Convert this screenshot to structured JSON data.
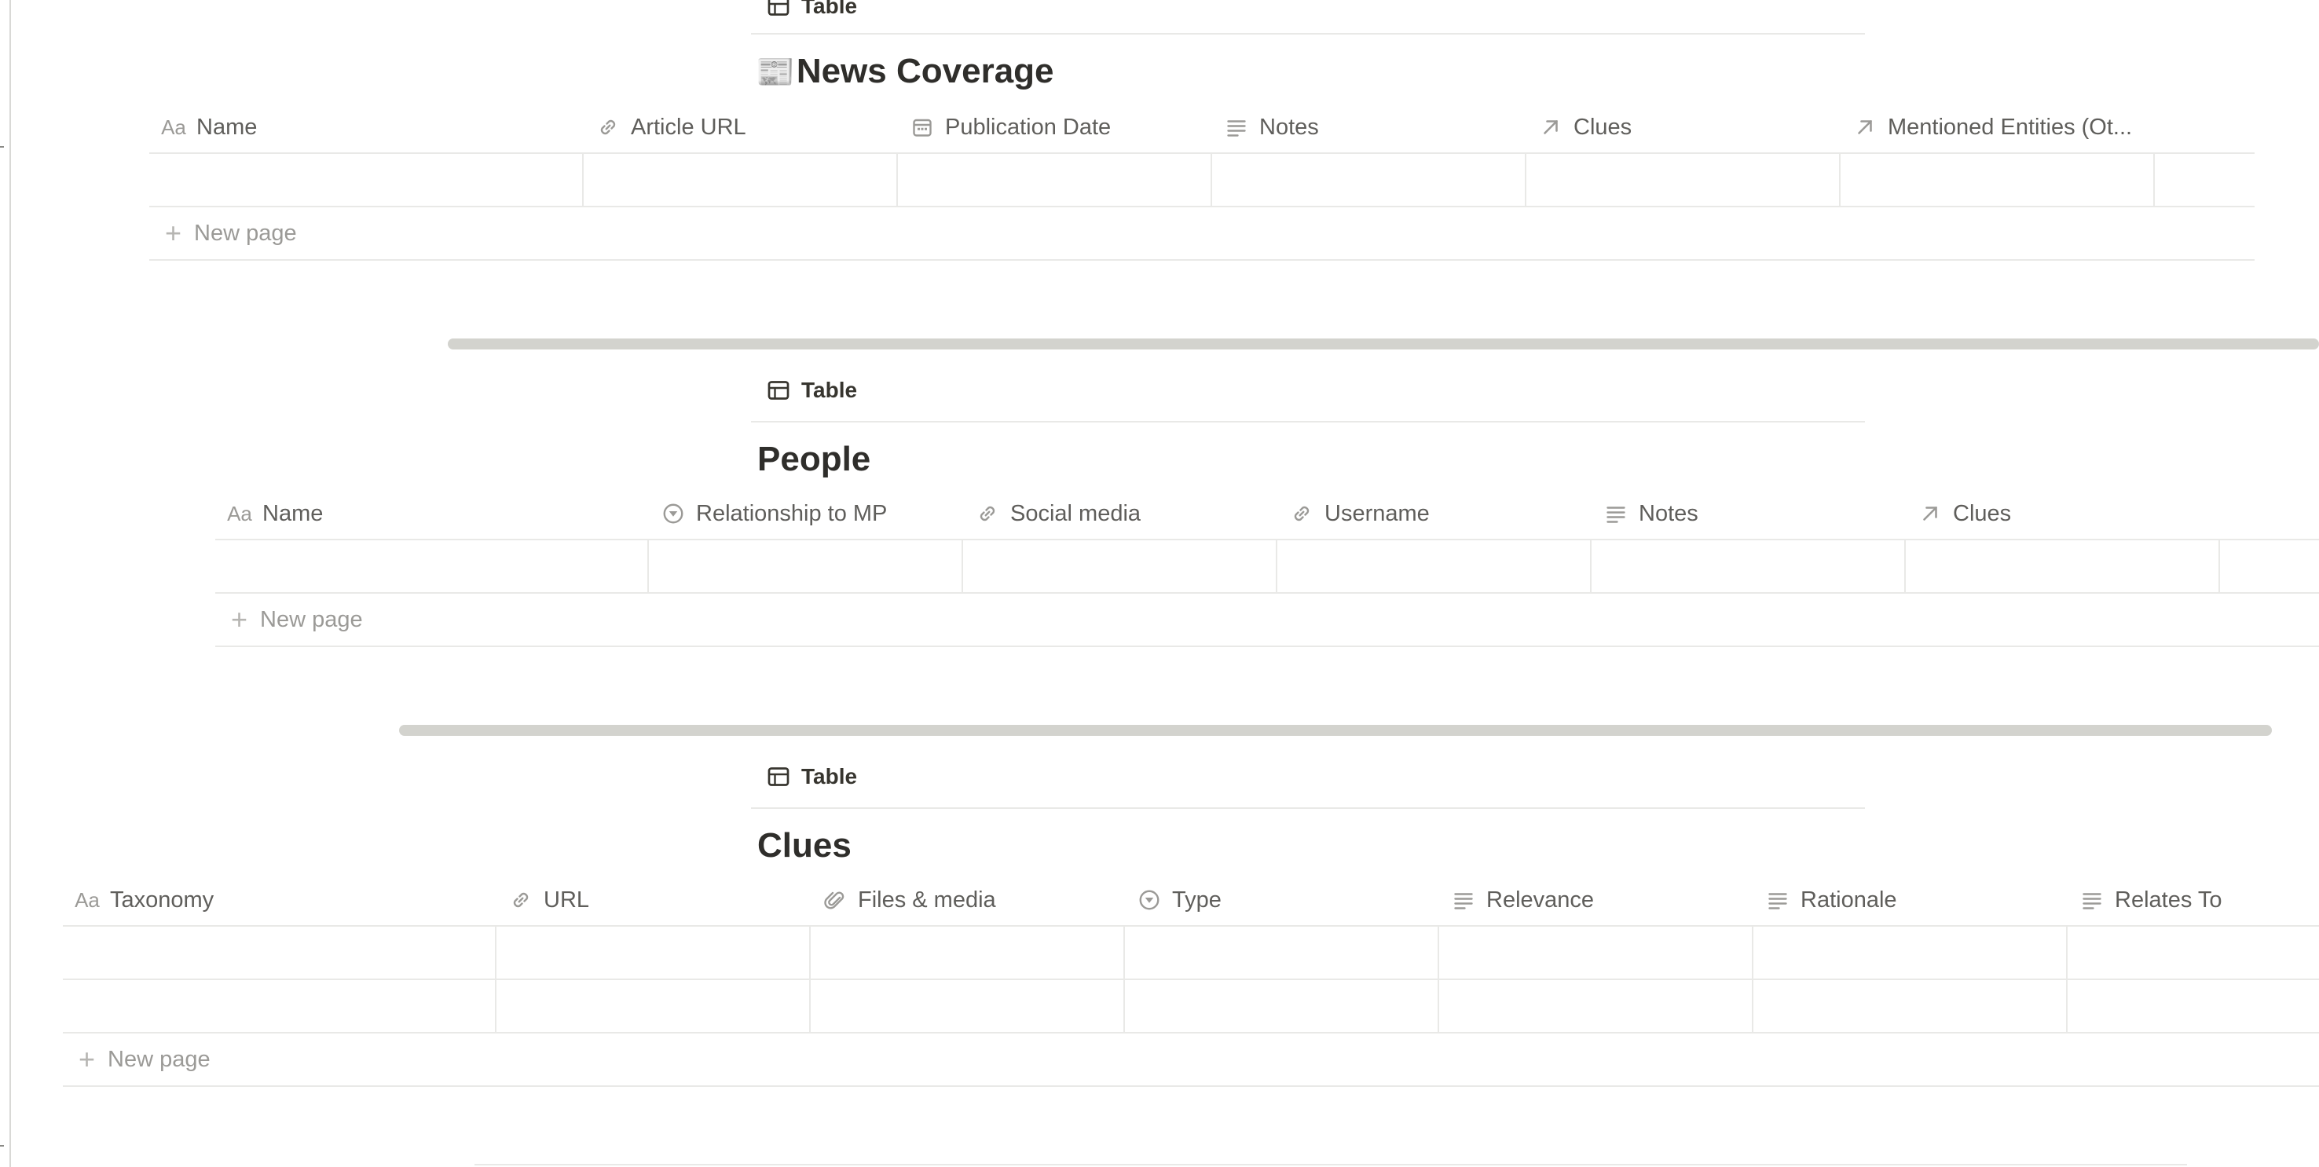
{
  "sections": {
    "news": {
      "view_tab": "Table",
      "emoji": "📰",
      "title": "News Coverage",
      "columns": [
        {
          "label": "Name",
          "icon": "title-aa-icon"
        },
        {
          "label": "Article URL",
          "icon": "link-icon"
        },
        {
          "label": "Publication Date",
          "icon": "calendar-icon"
        },
        {
          "label": "Notes",
          "icon": "text-lines-icon"
        },
        {
          "label": "Clues",
          "icon": "relation-arrow-icon"
        },
        {
          "label": "Mentioned Entities (Ot...",
          "icon": "relation-arrow-icon"
        }
      ],
      "new_page": "New page"
    },
    "people": {
      "view_tab": "Table",
      "title": "People",
      "columns": [
        {
          "label": "Name",
          "icon": "title-aa-icon"
        },
        {
          "label": "Relationship to MP",
          "icon": "select-icon"
        },
        {
          "label": "Social media",
          "icon": "link-icon"
        },
        {
          "label": "Username",
          "icon": "link-icon"
        },
        {
          "label": "Notes",
          "icon": "text-lines-icon"
        },
        {
          "label": "Clues",
          "icon": "relation-arrow-icon"
        }
      ],
      "new_page": "New page"
    },
    "clues": {
      "view_tab": "Table",
      "title": "Clues",
      "columns": [
        {
          "label": "Taxonomy",
          "icon": "title-aa-icon"
        },
        {
          "label": "URL",
          "icon": "link-icon"
        },
        {
          "label": "Files & media",
          "icon": "paperclip-icon"
        },
        {
          "label": "Type",
          "icon": "select-icon"
        },
        {
          "label": "Relevance",
          "icon": "text-lines-icon"
        },
        {
          "label": "Rationale",
          "icon": "text-lines-icon"
        },
        {
          "label": "Relates To",
          "icon": "text-lines-icon"
        }
      ],
      "new_page": "New page"
    }
  },
  "icon_glyphs": {
    "title_aa": "Aa"
  },
  "colors": {
    "text": "#37352f",
    "muted": "#787774",
    "border": "#e9e9e7",
    "scrollbar": "#d3d3ce"
  }
}
